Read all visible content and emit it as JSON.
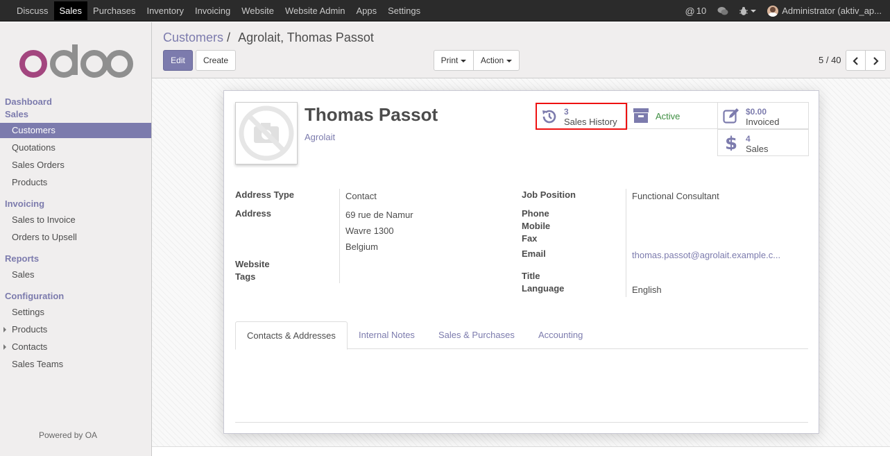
{
  "topnav": {
    "items": [
      "Discuss",
      "Sales",
      "Purchases",
      "Inventory",
      "Invoicing",
      "Website",
      "Website Admin",
      "Apps",
      "Settings"
    ],
    "mentions_count": "10",
    "user": "Administrator (aktiv_ap..."
  },
  "sidebar": {
    "dashboard": "Dashboard",
    "sales_section": "Sales",
    "sales_items": [
      "Customers",
      "Quotations",
      "Sales Orders",
      "Products"
    ],
    "invoicing_section": "Invoicing",
    "invoicing_items": [
      "Sales to Invoice",
      "Orders to Upsell"
    ],
    "reports_section": "Reports",
    "reports_items": [
      "Sales"
    ],
    "config_section": "Configuration",
    "config_items": [
      "Settings",
      "Products",
      "Contacts",
      "Sales Teams"
    ],
    "powered_by": "Powered by OA"
  },
  "breadcrumb": {
    "parent": "Customers",
    "separator": "/",
    "current": "Agrolait, Thomas Passot"
  },
  "buttons": {
    "edit": "Edit",
    "create": "Create",
    "print": "Print",
    "action": "Action"
  },
  "pager": {
    "value": "5 / 40"
  },
  "partner": {
    "name": "Thomas Passot",
    "company": "Agrolait"
  },
  "smart_buttons": {
    "sales_history_value": "3",
    "sales_history_label": "Sales History",
    "active_label": "Active",
    "invoiced_value": "$0.00",
    "invoiced_label": "Invoiced",
    "sales_value": "4",
    "sales_label": "Sales"
  },
  "fields_left": {
    "address_type_label": "Address Type",
    "address_type_value": "Contact",
    "address_label": "Address",
    "address_street": "69 rue de Namur",
    "address_city": "Wavre 1300",
    "address_country": "Belgium",
    "website_label": "Website",
    "tags_label": "Tags"
  },
  "fields_right": {
    "job_label": "Job Position",
    "job_value": "Functional Consultant",
    "phone_label": "Phone",
    "mobile_label": "Mobile",
    "fax_label": "Fax",
    "email_label": "Email",
    "email_value": "thomas.passot@agrolait.example.c...",
    "title_label": "Title",
    "language_label": "Language",
    "language_value": "English"
  },
  "tabs": [
    "Contacts & Addresses",
    "Internal Notes",
    "Sales & Purchases",
    "Accounting"
  ],
  "colors": {
    "brand": "#7c7bad",
    "active_green": "#3e8e41",
    "highlight": "#ee1111"
  }
}
